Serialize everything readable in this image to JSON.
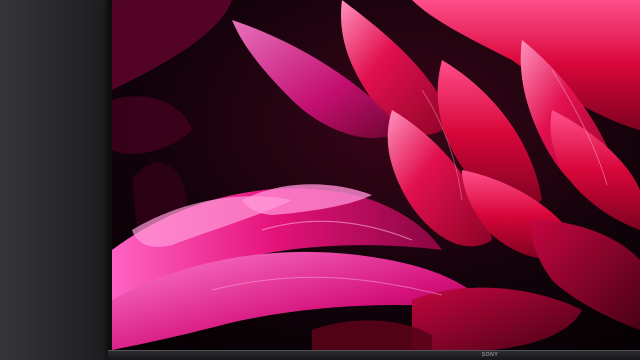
{
  "device": {
    "brand_logo_text": "SONY"
  },
  "screen_content": {
    "subject": "flower-closeup"
  },
  "colors": {
    "petal_magenta": "#e4127a",
    "petal_light": "#ff6cc0",
    "petal_red": "#c0062e",
    "background_dark": "#060104",
    "tv_bezel": "#0d0d0e",
    "wall": "#26272a"
  }
}
